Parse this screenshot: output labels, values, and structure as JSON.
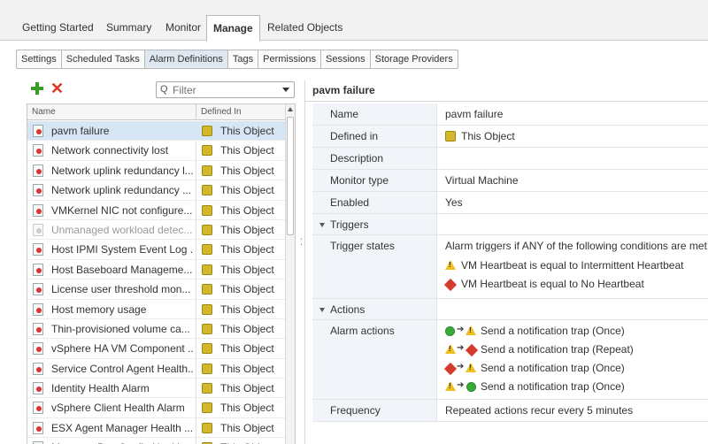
{
  "top_tabs": [
    {
      "label": "Getting Started",
      "active": false
    },
    {
      "label": "Summary",
      "active": false
    },
    {
      "label": "Monitor",
      "active": false
    },
    {
      "label": "Manage",
      "active": true
    },
    {
      "label": "Related Objects",
      "active": false
    }
  ],
  "sub_tabs": [
    {
      "label": "Settings",
      "active": false
    },
    {
      "label": "Scheduled Tasks",
      "active": false
    },
    {
      "label": "Alarm Definitions",
      "active": true
    },
    {
      "label": "Tags",
      "active": false
    },
    {
      "label": "Permissions",
      "active": false
    },
    {
      "label": "Sessions",
      "active": false
    },
    {
      "label": "Storage Providers",
      "active": false
    }
  ],
  "toolbar": {
    "add_icon": "plus-icon",
    "delete_icon": "x-icon",
    "delete_glyph": "✕"
  },
  "filter": {
    "placeholder": "Filter",
    "icon": "search-icon",
    "glyph": "Q"
  },
  "grid": {
    "columns": [
      "Name",
      "Defined In"
    ],
    "rows": [
      {
        "name": "pavm failure",
        "defined_in": "This Object",
        "selected": true,
        "enabled": true
      },
      {
        "name": "Network connectivity lost",
        "defined_in": "This Object",
        "selected": false,
        "enabled": true
      },
      {
        "name": "Network uplink redundancy l...",
        "defined_in": "This Object",
        "selected": false,
        "enabled": true
      },
      {
        "name": "Network uplink redundancy ...",
        "defined_in": "This Object",
        "selected": false,
        "enabled": true
      },
      {
        "name": "VMKernel NIC not configure...",
        "defined_in": "This Object",
        "selected": false,
        "enabled": true
      },
      {
        "name": "Unmanaged workload detec...",
        "defined_in": "This Object",
        "selected": false,
        "enabled": false
      },
      {
        "name": "Host IPMI System Event Log ...",
        "defined_in": "This Object",
        "selected": false,
        "enabled": true
      },
      {
        "name": "Host Baseboard Manageme...",
        "defined_in": "This Object",
        "selected": false,
        "enabled": true
      },
      {
        "name": "License user threshold mon...",
        "defined_in": "This Object",
        "selected": false,
        "enabled": true
      },
      {
        "name": "Host memory usage",
        "defined_in": "This Object",
        "selected": false,
        "enabled": true
      },
      {
        "name": "Thin-provisioned volume ca...",
        "defined_in": "This Object",
        "selected": false,
        "enabled": true
      },
      {
        "name": "vSphere HA VM Component ...",
        "defined_in": "This Object",
        "selected": false,
        "enabled": true
      },
      {
        "name": "Service Control Agent Health...",
        "defined_in": "This Object",
        "selected": false,
        "enabled": true
      },
      {
        "name": "Identity Health Alarm",
        "defined_in": "This Object",
        "selected": false,
        "enabled": true
      },
      {
        "name": "vSphere Client Health Alarm",
        "defined_in": "This Object",
        "selected": false,
        "enabled": true
      },
      {
        "name": "ESX Agent Manager Health ...",
        "defined_in": "This Object",
        "selected": false,
        "enabled": true
      },
      {
        "name": "Message Bus Config Health ...",
        "defined_in": "This Object",
        "selected": false,
        "enabled": true
      }
    ]
  },
  "details": {
    "title": "pavm failure",
    "name_label": "Name",
    "name_value": "pavm failure",
    "defined_in_label": "Defined in",
    "defined_in_value": "This Object",
    "description_label": "Description",
    "description_value": "",
    "monitor_type_label": "Monitor type",
    "monitor_type_value": "Virtual Machine",
    "enabled_label": "Enabled",
    "enabled_value": "Yes",
    "triggers_section": "Triggers",
    "trigger_states_label": "Trigger states",
    "trigger_intro": "Alarm triggers if ANY of the following conditions are met:",
    "triggers": [
      {
        "icon": "warning-icon",
        "text": "VM Heartbeat is equal to Intermittent Heartbeat"
      },
      {
        "icon": "critical-icon",
        "text": "VM Heartbeat is equal to No Heartbeat"
      }
    ],
    "actions_section": "Actions",
    "alarm_actions_label": "Alarm actions",
    "actions": [
      {
        "from": "ok-icon",
        "to": "warning-icon",
        "text": "Send a notification trap (Once)"
      },
      {
        "from": "warning-icon",
        "to": "critical-icon",
        "text": "Send a notification trap (Repeat)"
      },
      {
        "from": "critical-icon",
        "to": "warning-icon",
        "text": "Send a notification trap (Once)"
      },
      {
        "from": "warning-icon",
        "to": "ok-icon",
        "text": "Send a notification trap (Once)"
      }
    ],
    "frequency_label": "Frequency",
    "frequency_value": "Repeated actions recur every 5 minutes"
  },
  "colors": {
    "selected_row": "#d6e6f5",
    "warning": "#f0c020",
    "critical": "#d63a2a",
    "ok": "#3aaa3a",
    "add": "#3a9a2a"
  }
}
